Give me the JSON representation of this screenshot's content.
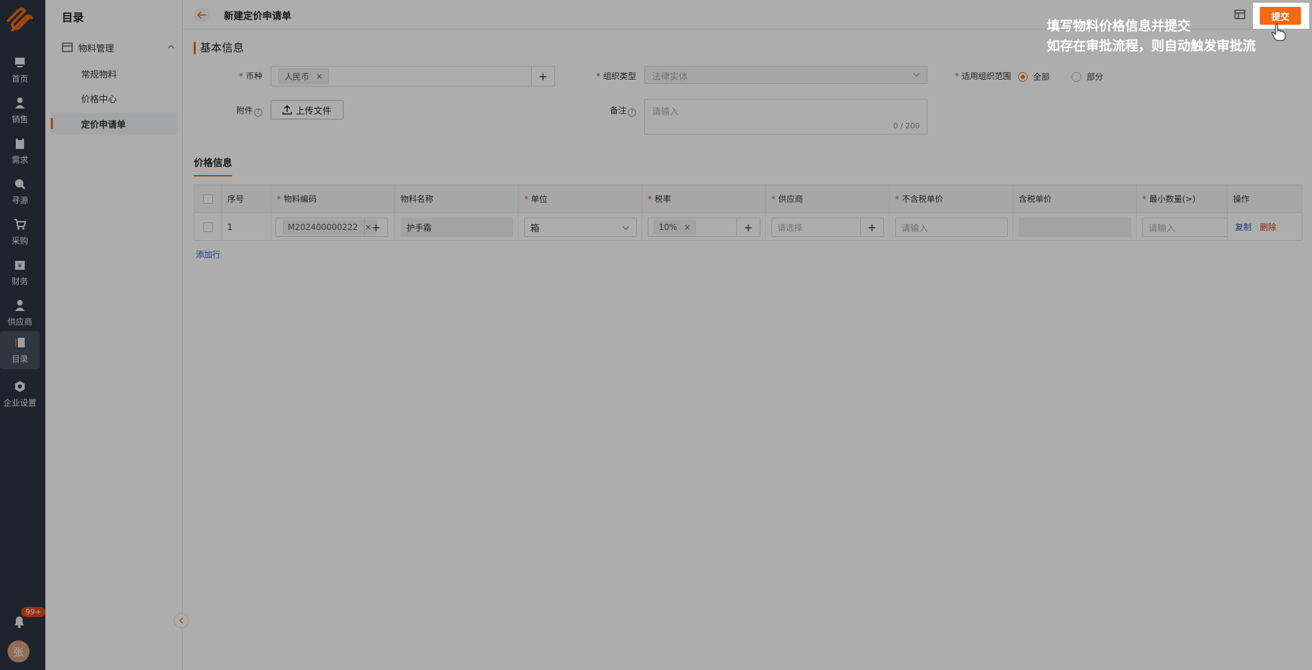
{
  "rail": {
    "items": [
      {
        "label": "首页",
        "icon": "home-icon"
      },
      {
        "label": "销售",
        "icon": "sales-icon"
      },
      {
        "label": "需求",
        "icon": "clipboard-icon"
      },
      {
        "label": "寻源",
        "icon": "search-icon"
      },
      {
        "label": "采购",
        "icon": "cart-icon"
      },
      {
        "label": "财务",
        "icon": "finance-icon"
      },
      {
        "label": "供应商",
        "icon": "supplier-icon"
      },
      {
        "label": "目录",
        "icon": "catalog-icon"
      },
      {
        "label": "企业设置",
        "icon": "settings-icon"
      }
    ],
    "badge": "99+",
    "avatar": "张"
  },
  "sidebar": {
    "title": "目录",
    "group": "物料管理",
    "items": [
      "常规物料",
      "价格中心",
      "定价申请单"
    ]
  },
  "header": {
    "title": "新建定价申请单",
    "submit": "提交"
  },
  "basic": {
    "section_title": "基本信息",
    "currency_label": "币种",
    "currency_value": "人民币",
    "org_type_label": "组织类型",
    "org_type_placeholder": "法律实体",
    "scope_label": "适用组织范围",
    "scope_options": [
      "全部",
      "部分"
    ],
    "attachment_label": "附件",
    "upload": "上传文件",
    "remark_label": "备注",
    "remark_placeholder": "请输入",
    "remark_counter": "0 / 200"
  },
  "price": {
    "tab": "价格信息",
    "columns": [
      "序号",
      "物料编码",
      "物料名称",
      "单位",
      "税率",
      "供应商",
      "不含税单价",
      "含税单价",
      "最小数量(>)",
      "操作"
    ],
    "row": {
      "index": "1",
      "code": "M202400000222",
      "name": "护手霜",
      "unit": "箱",
      "tax": "10%",
      "supplier_placeholder": "请选择",
      "price_placeholder": "请输入",
      "min_placeholder": "请输入",
      "copy": "复制",
      "delete": "删除"
    },
    "add_row": "添加行"
  },
  "tip": {
    "line1": "填写物料价格信息并提交",
    "line2": "如存在审批流程，则自动触发审批流"
  },
  "colors": {
    "accent": "#f26a12",
    "rail": "#2b3544",
    "link": "#1f5fbf"
  }
}
